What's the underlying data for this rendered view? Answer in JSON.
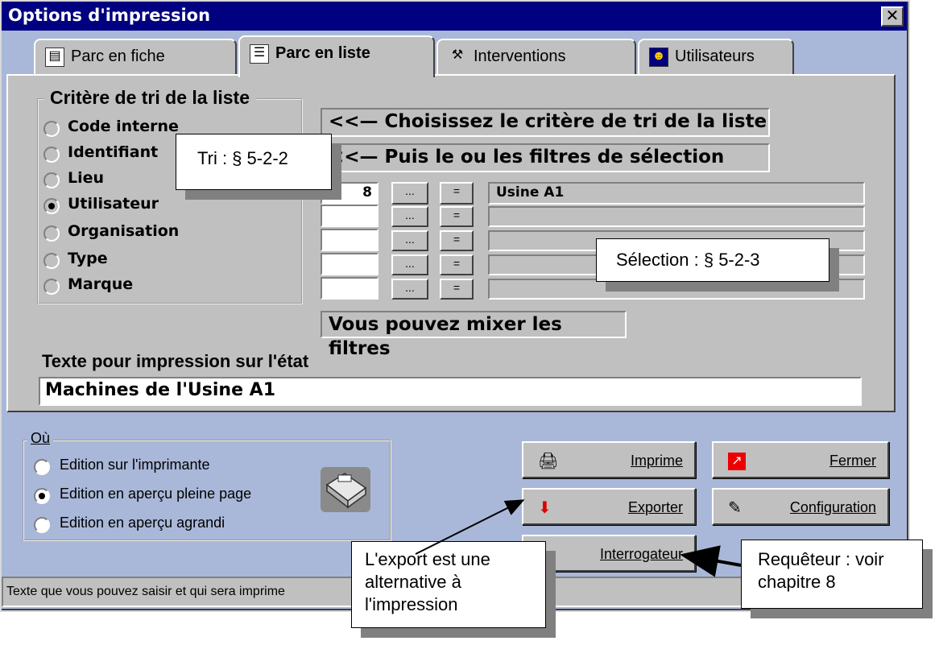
{
  "window": {
    "title": "Options d'impression",
    "close_label": "✕"
  },
  "tabs": [
    {
      "label": "Parc en fiche",
      "icon": "form-icon"
    },
    {
      "label": "Parc en liste",
      "icon": "list-icon"
    },
    {
      "label": "Interventions",
      "icon": "hammer-icon"
    },
    {
      "label": "Utilisateurs",
      "icon": "user-icon"
    }
  ],
  "sort": {
    "title": "Critère de tri de la liste",
    "options": [
      "Code interne",
      "Identifiant",
      "Lieu",
      "Utilisateur",
      "Organisation",
      "Type",
      "Marque"
    ],
    "selected": "Utilisateur"
  },
  "hints": {
    "choose_sort": "<<— Choisissez le critère de tri de la liste",
    "then_filters": "<<— Puis le ou les filtres de sélection",
    "mix": "Vous pouvez mixer les filtres"
  },
  "filters": {
    "browse_label": "...",
    "equals_label": "=",
    "rows": [
      {
        "code": "8",
        "value": "Usine A1"
      },
      {
        "code": "",
        "value": ""
      },
      {
        "code": "",
        "value": ""
      },
      {
        "code": "",
        "value": ""
      },
      {
        "code": "",
        "value": ""
      }
    ]
  },
  "print_text": {
    "label": "Texte pour impression sur l'état",
    "value": "Machines de l'Usine A1"
  },
  "where": {
    "title": "Où",
    "options": [
      "Edition sur l'imprimante",
      "Edition en aperçu pleine page",
      "Edition en aperçu agrandi"
    ],
    "selected": "Edition en aperçu pleine page"
  },
  "buttons": {
    "print": "Imprime",
    "close": "Fermer",
    "export": "Exporter",
    "config": "Configuration",
    "query": "Interrogateur"
  },
  "status": "Texte que vous pouvez saisir et qui sera imprime",
  "callouts": {
    "tri": "Tri : § 5-2-2",
    "selection": "Sélection : § 5-2-3",
    "export": "L'export est une alternative à l'impression",
    "requeteur": "Requêteur : voir chapitre 8"
  },
  "colors": {
    "title_bar": "#000080",
    "window_bg": "#a9b8d8",
    "face": "#c0c0c0"
  }
}
